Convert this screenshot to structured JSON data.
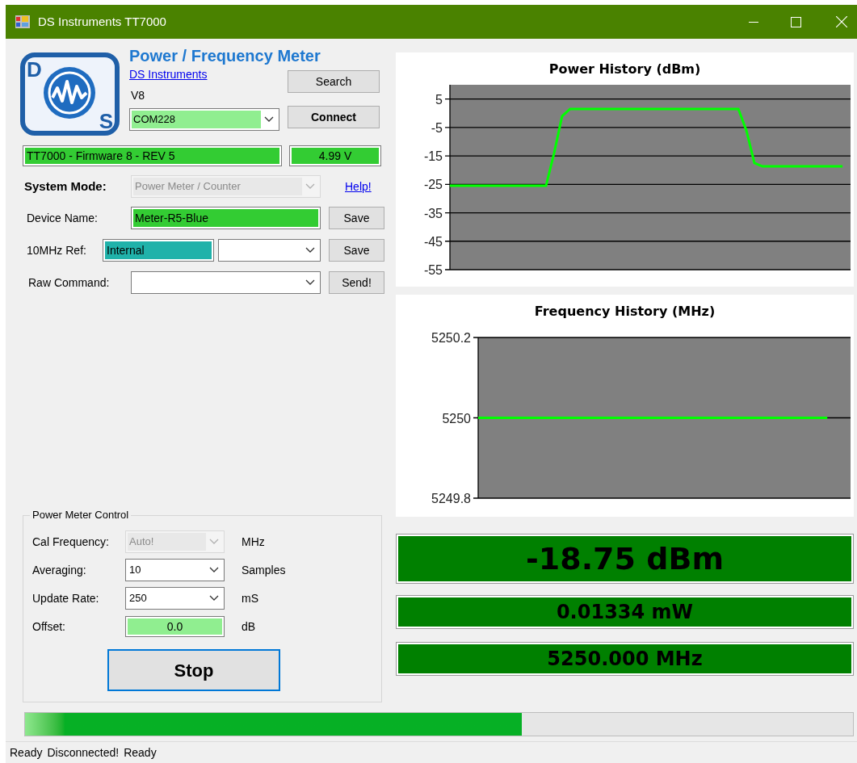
{
  "window": {
    "title": "DS Instruments TT7000"
  },
  "logo": {
    "letters": [
      "D",
      "S"
    ]
  },
  "header": {
    "title": "Power / Frequency Meter",
    "link": "DS Instruments",
    "version": "V8",
    "port": "COM228",
    "search_button": "Search",
    "connect_button": "Connect"
  },
  "device_info": {
    "firmware": "TT7000 - Firmware 8 - REV 5",
    "voltage": "4.99 V"
  },
  "system_mode": {
    "label": "System Mode:",
    "value": "Power Meter / Counter",
    "disabled": true,
    "help_link": "Help!"
  },
  "device_name": {
    "label": "Device Name:",
    "value": "Meter-R5-Blue",
    "button": "Save"
  },
  "ref_10mhz": {
    "label": "10MHz Ref:",
    "value": "Internal",
    "button": "Save"
  },
  "raw_command": {
    "label": "Raw Command:",
    "button": "Send!"
  },
  "power_meter_control": {
    "title": "Power Meter Control",
    "rows": [
      {
        "kind": "combo",
        "label": "Cal Frequency:",
        "value": "Auto!",
        "unit": "MHz",
        "disabled": true
      },
      {
        "kind": "combo",
        "label": "Averaging:",
        "value": "10",
        "unit": "Samples",
        "disabled": false
      },
      {
        "kind": "combo",
        "label": "Update Rate:",
        "value": "250",
        "unit": "mS",
        "disabled": false
      },
      {
        "kind": "field",
        "label": "Offset:",
        "value": "0.0",
        "unit": "dB"
      }
    ],
    "button": "Stop"
  },
  "power_chart": {
    "chart_data": {
      "type": "line",
      "title": "Power History (dBm)",
      "categories": [
        null,
        null,
        null,
        null,
        null,
        null,
        null,
        null,
        null,
        null,
        null,
        null,
        null,
        null,
        null,
        null,
        null,
        null,
        null,
        null,
        null,
        null,
        null,
        null,
        null,
        null,
        null,
        null,
        null,
        null,
        null,
        null,
        null,
        null,
        null,
        null,
        null,
        null,
        null,
        null,
        null,
        null,
        null,
        null,
        null,
        null,
        null,
        null,
        null,
        null,
        null
      ],
      "series": [
        {
          "color": "#00ff00",
          "values": [
            -25.5,
            -25.5,
            -25.5,
            -25.5,
            -25.5,
            -25.5,
            -25.5,
            -25.5,
            -25.5,
            -25.5,
            -25.5,
            -25.5,
            -25.5,
            -14,
            -1,
            1.5,
            1.5,
            1.5,
            1.5,
            1.5,
            1.5,
            1.5,
            1.5,
            1.5,
            1.5,
            1.5,
            1.5,
            1.5,
            1.5,
            1.5,
            1.5,
            1.5,
            1.5,
            1.5,
            1.5,
            1.5,
            1.5,
            -6,
            -17.5,
            -18.7,
            -18.7,
            -18.7,
            -18.7,
            -18.7,
            -18.7,
            -18.7,
            -18.7,
            -18.7,
            -18.7,
            -18.7,
            null
          ]
        }
      ],
      "ylim": [
        -55,
        10
      ],
      "grid": true,
      "yticks": [
        {
          "value": 5,
          "label": "5"
        },
        {
          "value": -5,
          "label": "-5"
        },
        {
          "value": -15,
          "label": "-15"
        },
        {
          "value": -25,
          "label": "-25"
        },
        {
          "value": -35,
          "label": "-35"
        },
        {
          "value": -45,
          "label": "-45"
        },
        {
          "value": -55,
          "label": "-55"
        }
      ]
    }
  },
  "frequency_chart": {
    "chart_data": {
      "type": "line",
      "title": "Frequency History (MHz)",
      "categories": [
        null,
        null,
        null,
        null,
        null,
        null,
        null,
        null,
        null,
        null,
        null,
        null,
        null,
        null,
        null,
        null,
        null
      ],
      "series": [
        {
          "color": "#00ff00",
          "values": [
            5250,
            5250,
            5250,
            5250,
            5250,
            5250,
            5250,
            5250,
            5250,
            5250,
            5250,
            5250,
            5250,
            5250,
            5250,
            5250,
            null
          ]
        }
      ],
      "ylim": [
        5249.8,
        5250.2
      ],
      "grid": true,
      "yticks": [
        {
          "value": 5250.2,
          "label": "5250.2"
        },
        {
          "value": 5250,
          "label": "5250"
        },
        {
          "value": 5249.8,
          "label": "5249.8"
        }
      ]
    }
  },
  "readouts": [
    {
      "kind": "primary",
      "text": "-18.75 dBm"
    },
    {
      "kind": "secondary",
      "text": "0.01334 mW"
    },
    {
      "kind": "secondary",
      "text": "5250.000 MHz"
    }
  ],
  "progress": {
    "level": 0.6
  },
  "status_bar": [
    "Ready",
    "Disconnected!",
    "Ready"
  ]
}
